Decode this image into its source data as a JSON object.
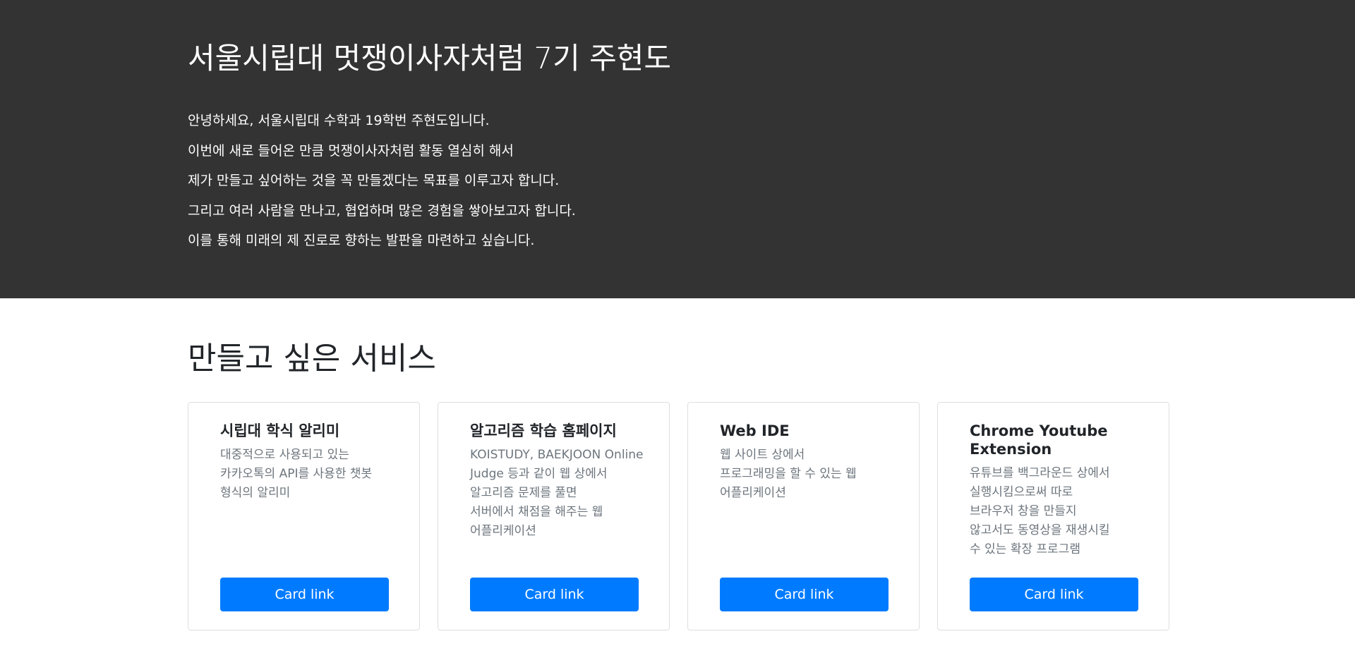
{
  "hero": {
    "title": "서울시립대 멋쟁이사자처럼 7기 주현도",
    "lines": [
      "안녕하세요, 서울시립대 수학과 19학번 주현도입니다.",
      "이번에 새로 들어온 만큼 멋쟁이사자처럼 활동 열심히 해서",
      "제가 만들고 싶어하는 것을 꼭 만들겠다는 목표를 이루고자 합니다.",
      "그리고 여러 사람을 만나고, 협업하며 많은 경험을 쌓아보고자 합니다.",
      "이를 통해 미래의 제 진로로 향하는 발판을 마련하고 싶습니다."
    ]
  },
  "services": {
    "title": "만들고 싶은 서비스",
    "cards": [
      {
        "title": "시립대 학식 알리미",
        "lines": [
          "대중적으로 사용되고 있는",
          "카카오톡의 API를 사용한 챗봇",
          "형식의 알리미"
        ],
        "link": "Card link"
      },
      {
        "title": "알고리즘 학습 홈페이지",
        "lines": [
          "KOISTUDY, BAEKJOON Online",
          "Judge 등과 같이 웹 상에서",
          "알고리즘 문제를 풀면",
          "서버에서 채점을 해주는 웹",
          "어플리케이션"
        ],
        "link": "Card link"
      },
      {
        "title": "Web IDE",
        "lines": [
          "웹 사이트 상에서",
          "프로그래밍을 할 수 있는 웹",
          "어플리케이션"
        ],
        "link": "Card link"
      },
      {
        "title": "Chrome Youtube Extension",
        "lines": [
          "유튜브를 백그라운드 상에서",
          "실행시킴으로써 따로",
          "브라우저 창을 만들지",
          "않고서도 동영상을 재생시킬",
          "수 있는 확장 프로그램"
        ],
        "link": "Card link"
      }
    ]
  }
}
